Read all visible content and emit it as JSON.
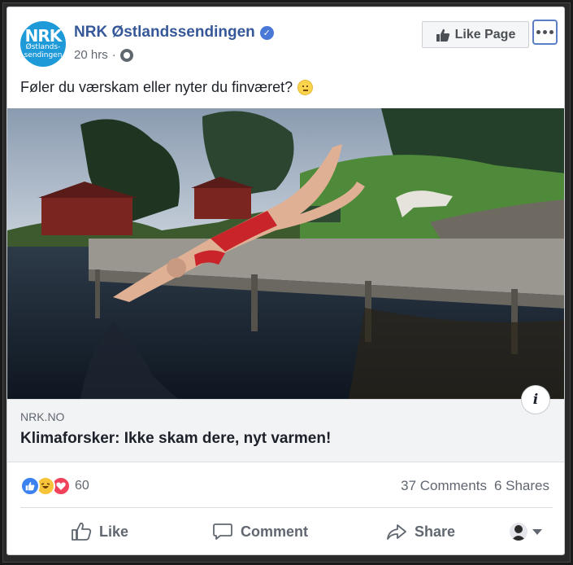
{
  "post": {
    "page_name": "NRK Østlandssendingen",
    "avatar_logo": "NRK",
    "avatar_sub_line1": "Østlands-",
    "avatar_sub_line2": "sendingen",
    "time": "20 hrs",
    "separator": "·",
    "text": "Føler du værskam eller nyter du finværet?",
    "like_page_label": "Like Page"
  },
  "link": {
    "domain": "NRK.NO",
    "title": "Klimaforsker: Ikke skam dere, nyt varmen!",
    "info_glyph": "i"
  },
  "stats": {
    "reaction_count": "60",
    "comments": "37 Comments",
    "shares": "6 Shares"
  },
  "actions": {
    "like": "Like",
    "comment": "Comment",
    "share": "Share"
  },
  "colors": {
    "brand_blue": "#365899",
    "nrk_blue": "#1f9ad9",
    "like_blue": "#3b82f0",
    "love_red": "#f0435b",
    "haha_yellow": "#f7c43a"
  },
  "icons": [
    "verified-icon",
    "globe-icon",
    "thumbs-up-icon",
    "more-icon",
    "smile-emoji-icon",
    "info-icon",
    "like-reaction-icon",
    "haha-reaction-icon",
    "love-reaction-icon",
    "comment-icon",
    "share-icon",
    "profile-icon",
    "caret-down-icon"
  ]
}
